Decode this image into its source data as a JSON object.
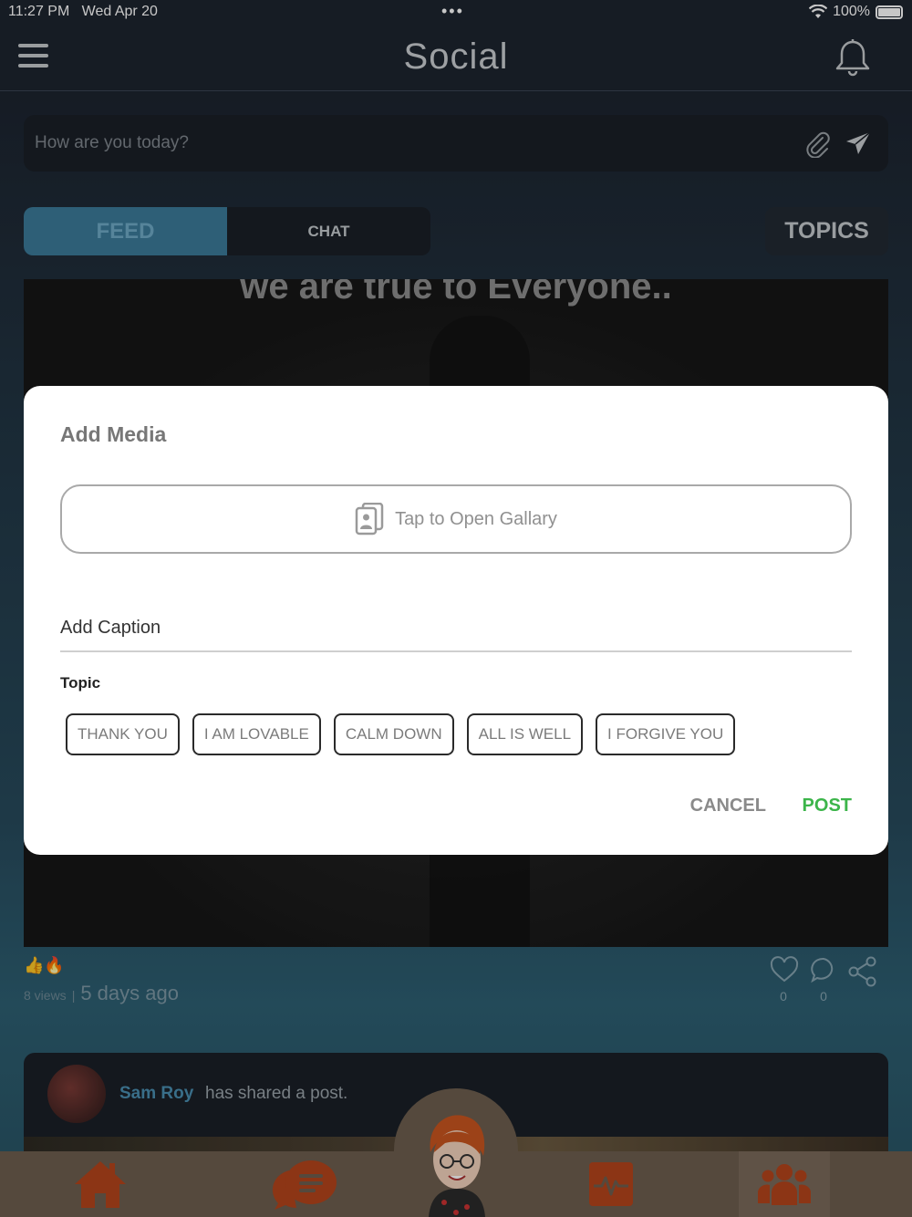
{
  "status_bar": {
    "time": "11:27 PM",
    "date": "Wed Apr 20",
    "dots": "•••",
    "battery": "100%"
  },
  "header": {
    "title": "Social",
    "menu_icon": "hamburger-menu-icon",
    "notification_icon": "bell-icon"
  },
  "composer": {
    "placeholder": "How are you today?",
    "attach_icon": "paperclip-icon",
    "send_icon": "paper-plane-icon"
  },
  "tabs": {
    "feed": "FEED",
    "chat": "CHAT",
    "topics": "TOPICS",
    "active": "FEED"
  },
  "feed_post": {
    "image_quote": "we are true to Everyone..",
    "reactions": "👍🔥",
    "views": "8 views",
    "separator": "|",
    "time_ago": "5 days ago",
    "likes": "0",
    "comments": "0"
  },
  "next_post": {
    "user": "Sam Roy",
    "action": "has shared a post."
  },
  "modal": {
    "title": "Add Media",
    "gallery_button": "Tap to Open Gallary",
    "caption_placeholder": "Add Caption",
    "topic_label": "Topic",
    "topics": [
      "THANK YOU",
      "I AM LOVABLE",
      "CALM DOWN",
      "ALL IS WELL",
      "I FORGIVE YOU"
    ],
    "cancel": "CANCEL",
    "post": "POST"
  },
  "colors": {
    "accent_blue": "#3b7a99",
    "post_green": "#3cb54a",
    "tabbar_brown": "#6d5e4f",
    "icon_orange": "#b4441b"
  }
}
